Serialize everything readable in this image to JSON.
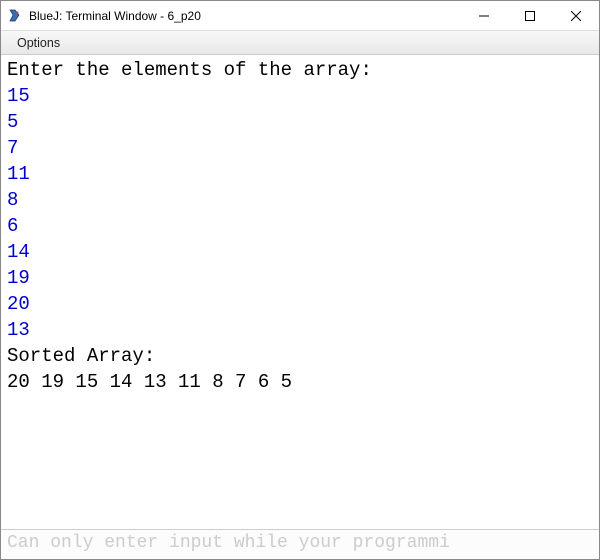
{
  "window": {
    "title": "BlueJ: Terminal Window - 6_p20"
  },
  "menubar": {
    "options": "Options"
  },
  "terminal": {
    "lines": [
      {
        "kind": "output",
        "text": "Enter the elements of the array:"
      },
      {
        "kind": "input",
        "text": "15"
      },
      {
        "kind": "input",
        "text": "5"
      },
      {
        "kind": "input",
        "text": "7"
      },
      {
        "kind": "input",
        "text": "11"
      },
      {
        "kind": "input",
        "text": "8"
      },
      {
        "kind": "input",
        "text": "6"
      },
      {
        "kind": "input",
        "text": "14"
      },
      {
        "kind": "input",
        "text": "19"
      },
      {
        "kind": "input",
        "text": "20"
      },
      {
        "kind": "input",
        "text": "13"
      },
      {
        "kind": "output",
        "text": "Sorted Array:"
      },
      {
        "kind": "output",
        "text": "20 19 15 14 13 11 8 7 6 5"
      }
    ]
  },
  "status": {
    "text": "Can only enter input while your programmi"
  }
}
